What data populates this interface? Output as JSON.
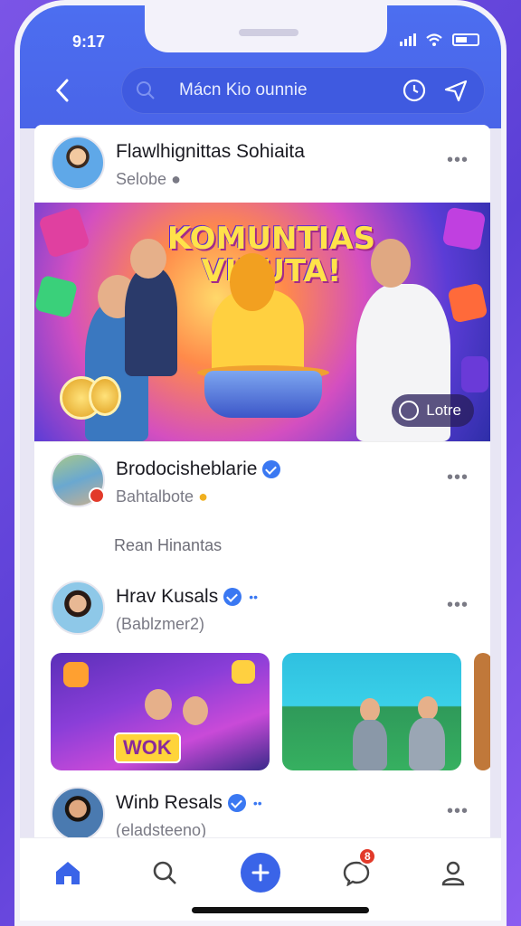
{
  "status_bar": {
    "time": "9:17"
  },
  "header": {
    "search_text": "Mácn Kio ounnie",
    "back_icon": "chevron-left-icon",
    "history_icon": "clock-icon",
    "send_icon": "send-icon"
  },
  "posts": [
    {
      "name": "Flawlhignittas Sohiaita",
      "subtitle": "Selobe",
      "verified": false,
      "banner": {
        "title": "KOMUNTIAS VIBUTA!",
        "button_label": "Lotre",
        "button_icon": "comment-icon"
      }
    },
    {
      "name": "Brodocisheblarie",
      "subtitle": "Bahtalbote",
      "verified": true,
      "caption": "Rean Hinantas"
    },
    {
      "name": "Hrav Kusals",
      "subtitle": "(Bablzmer2)",
      "verified": true,
      "thumbs": [
        {
          "label": "WOK"
        },
        {
          "label": ""
        }
      ]
    },
    {
      "name": "Winb Resals",
      "subtitle": "(eladsteeno)",
      "verified": true
    }
  ],
  "bottom_nav": {
    "items": [
      "home-icon",
      "search-icon",
      "add-icon",
      "chat-icon",
      "profile-icon"
    ],
    "chat_badge": "8"
  },
  "colors": {
    "accent": "#3a64e8",
    "header_bg": "#4c6ef0",
    "verified": "#3a78f2",
    "badge": "#e23a2a"
  }
}
